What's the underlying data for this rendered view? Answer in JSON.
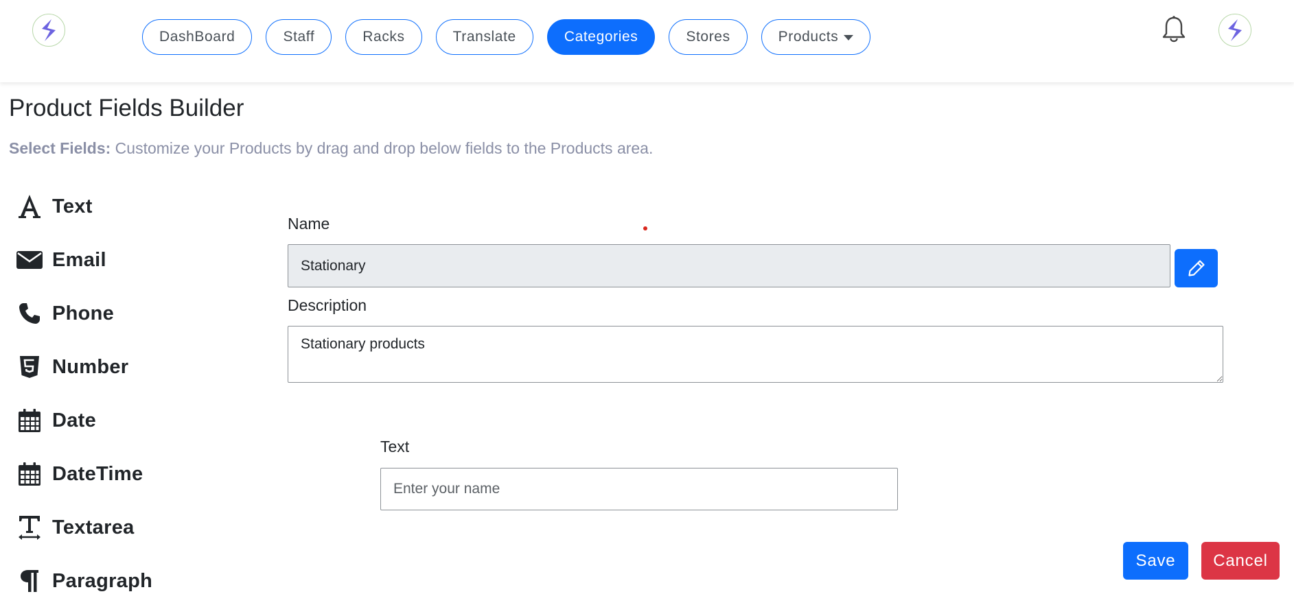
{
  "header": {
    "nav": [
      {
        "label": "DashBoard",
        "active": false
      },
      {
        "label": "Staff",
        "active": false
      },
      {
        "label": "Racks",
        "active": false
      },
      {
        "label": "Translate",
        "active": false
      },
      {
        "label": "Categories",
        "active": true
      },
      {
        "label": "Stores",
        "active": false
      },
      {
        "label": "Products",
        "active": false,
        "dropdown": true
      }
    ]
  },
  "page": {
    "title": "Product Fields Builder",
    "subtitle_strong": "Select Fields:",
    "subtitle_text": " Customize your Products by drag and drop below fields to the Products area."
  },
  "palette": [
    {
      "label": "Text",
      "icon": "font-icon"
    },
    {
      "label": "Email",
      "icon": "envelope-icon"
    },
    {
      "label": "Phone",
      "icon": "phone-icon"
    },
    {
      "label": "Number",
      "icon": "html5-icon"
    },
    {
      "label": "Date",
      "icon": "calendar-icon"
    },
    {
      "label": "DateTime",
      "icon": "calendar-icon"
    },
    {
      "label": "Textarea",
      "icon": "text-width-icon"
    },
    {
      "label": "Paragraph",
      "icon": "paragraph-icon"
    }
  ],
  "form": {
    "name_label": "Name",
    "name_value": "Stationary",
    "description_label": "Description",
    "description_value": "Stationary products",
    "text_label": "Text",
    "text_placeholder": "Enter your name",
    "save_label": "Save",
    "cancel_label": "Cancel"
  },
  "colors": {
    "primary": "#0d6efd",
    "danger": "#dc3545",
    "subtitle": "#8a8fa6",
    "readonly_bg": "#e9ecef"
  }
}
